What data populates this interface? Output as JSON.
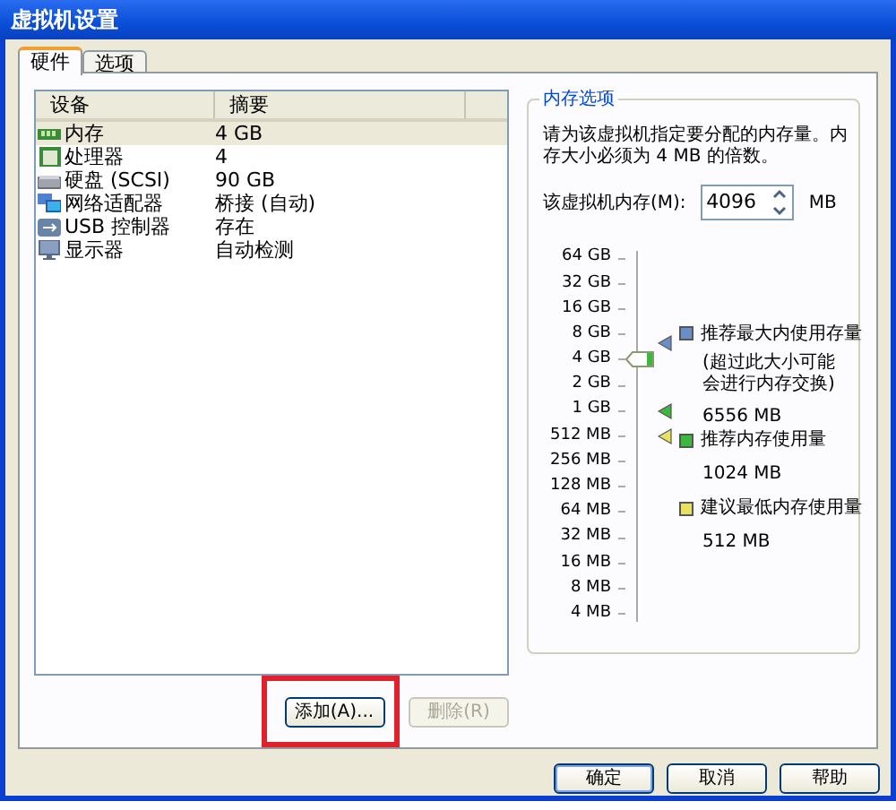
{
  "window": {
    "title": "虚拟机设置"
  },
  "tabs": [
    {
      "label": "硬件",
      "selected": true
    },
    {
      "label": "选项",
      "selected": false
    }
  ],
  "devices": {
    "columns": [
      "设备",
      "摘要"
    ],
    "rows": [
      {
        "kind": "memory",
        "device": "内存",
        "summary": "4 GB",
        "selected": true
      },
      {
        "kind": "processor",
        "device": "处理器",
        "summary": "4",
        "selected": false
      },
      {
        "kind": "disk",
        "device": "硬盘 (SCSI)",
        "summary": "90 GB",
        "selected": false
      },
      {
        "kind": "network",
        "device": "网络适配器",
        "summary": "桥接 (自动)",
        "selected": false
      },
      {
        "kind": "usb",
        "device": "USB 控制器",
        "summary": "存在",
        "selected": false
      },
      {
        "kind": "display",
        "device": "显示器",
        "summary": "自动检测",
        "selected": false
      }
    ]
  },
  "list_buttons": [
    {
      "label": "添加(A)...",
      "disabled": false,
      "highlighted": true
    },
    {
      "label": "删除(R)",
      "disabled": true,
      "highlighted": false
    }
  ],
  "memory": {
    "title": "内存选项",
    "description": "请为该虚拟机指定要分配的内存量。内存大小必须为 4 MB 的倍数。",
    "field_label": "该虚拟机内存(M):",
    "value": "4096",
    "unit": "MB",
    "slider": {
      "level": 0.714,
      "ticks": [
        "64 GB",
        "32 GB",
        "16 GB",
        "8 GB",
        "4 GB",
        "2 GB",
        "1 GB",
        "512 MB",
        "256 MB",
        "128 MB",
        "64 MB",
        "32 MB",
        "16 MB",
        "8 MB",
        "4 MB"
      ]
    },
    "recommendations": [
      {
        "color": "#6a8fc8",
        "title": "推荐最大内使用存量",
        "note": "(超过此大小可能会进行内存交换)",
        "value": "6556 MB"
      },
      {
        "color": "#3cb83c",
        "title": "推荐内存使用量",
        "value": "1024 MB"
      },
      {
        "color": "#e8e060",
        "title": "建议最低内存使用量",
        "value": "512 MB"
      }
    ]
  },
  "buttons": [
    {
      "label": "确定",
      "default": true
    },
    {
      "label": "取消",
      "default": false
    },
    {
      "label": "帮助",
      "default": false
    }
  ]
}
